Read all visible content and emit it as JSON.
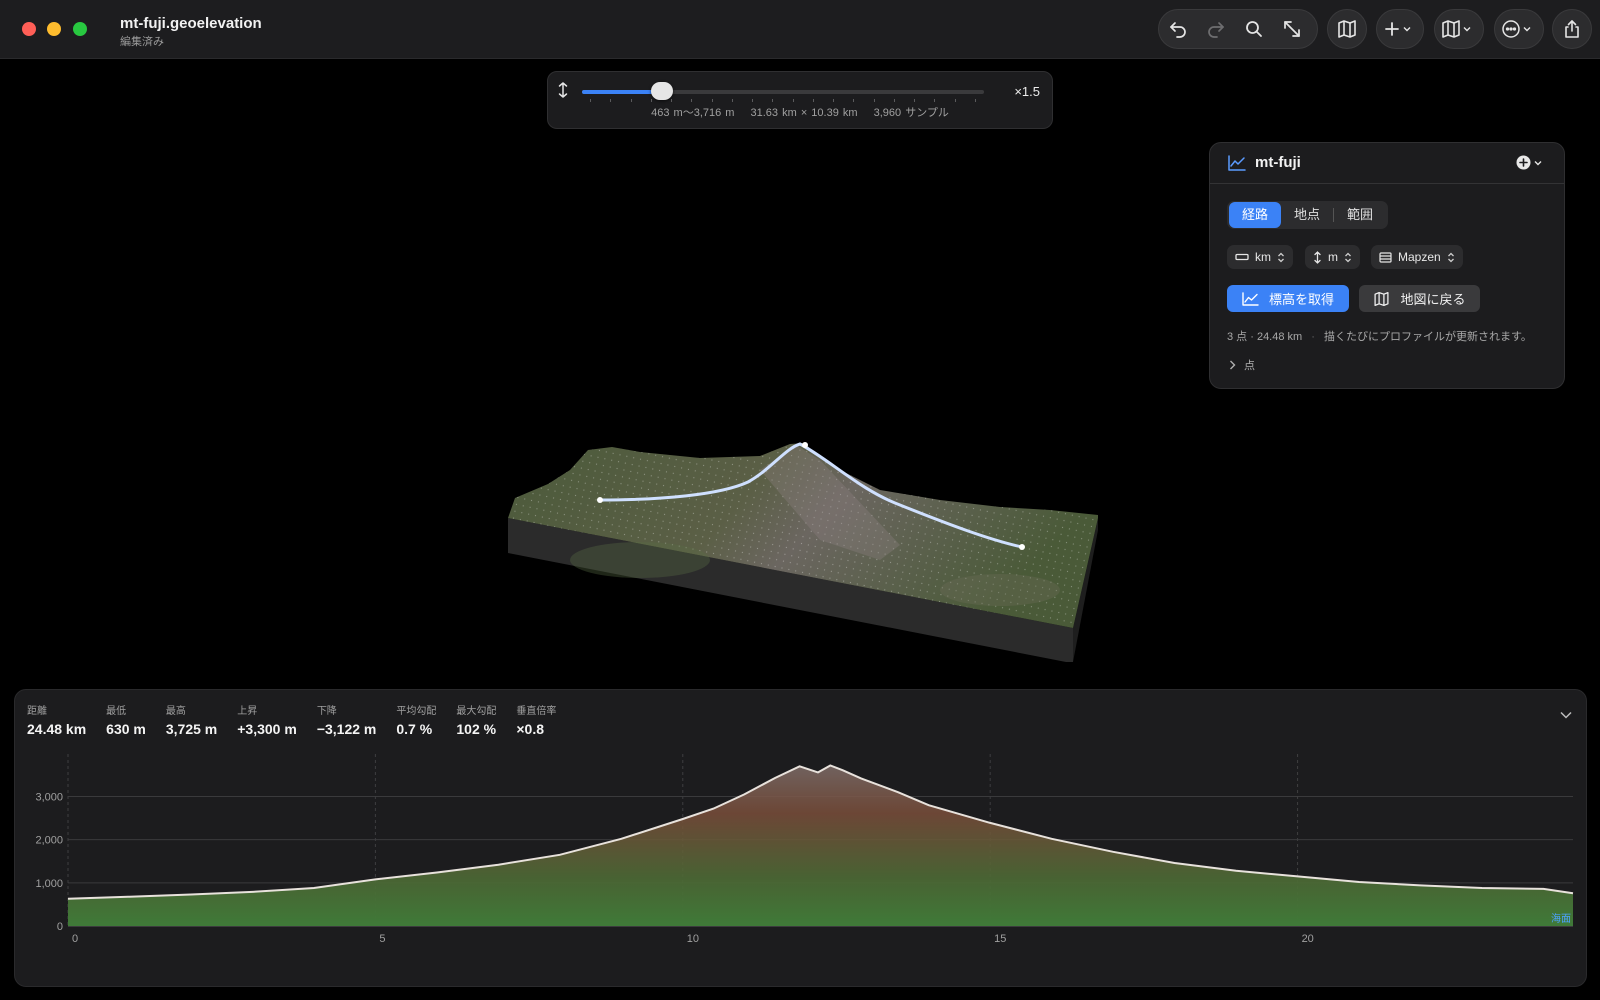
{
  "window": {
    "title": "mt-fuji.geoelevation",
    "subtitle": "編集済み"
  },
  "toolbar": {
    "undo": "undo-icon",
    "redo": "redo-icon",
    "search": "magnifier-icon",
    "fit": "fit-icon",
    "map_view": "map-icon",
    "add": "plus-icon",
    "map_style": "map-icon",
    "more": "ellipsis-icon",
    "share": "share-icon"
  },
  "exaggeration": {
    "multiplier": "×1.5",
    "slider_value": 0.2,
    "range_text": "463 m〜3,716 m",
    "size_text": "31.63 km × 10.39 km",
    "samples_text": "3,960 サンプル"
  },
  "inspector": {
    "title": "mt-fuji",
    "tabs": [
      {
        "label": "経路",
        "active": true
      },
      {
        "label": "地点",
        "active": false
      },
      {
        "label": "範囲",
        "active": false
      }
    ],
    "distance_unit": "km",
    "elevation_unit": "m",
    "source": "Mapzen",
    "fetch_button": "標高を取得",
    "back_button": "地図に戻る",
    "status_left": "3 点 · 24.48 km",
    "status_sep": "·",
    "status_right": "描くたびにプロファイルが更新されます。",
    "points_disclosure": "点"
  },
  "stats": [
    {
      "label": "距離",
      "value": "24.48 km"
    },
    {
      "label": "最低",
      "value": "630 m"
    },
    {
      "label": "最高",
      "value": "3,725 m"
    },
    {
      "label": "上昇",
      "value": "+3,300 m"
    },
    {
      "label": "下降",
      "value": "−3,122 m"
    },
    {
      "label": "平均勾配",
      "value": "0.7 %"
    },
    {
      "label": "最大勾配",
      "value": "102 %"
    },
    {
      "label": "垂直倍率",
      "value": "×0.8"
    }
  ],
  "chart_data": {
    "type": "area",
    "x_ticks": [
      "0",
      "5",
      "10",
      "15",
      "20"
    ],
    "y_ticks": [
      "0",
      "1,000",
      "2,000",
      "3,000"
    ],
    "xlim": [
      0,
      24.48
    ],
    "ylim": [
      0,
      3800
    ],
    "sea_level_label": "海面",
    "x": [
      0,
      1,
      2,
      3,
      4,
      5,
      6,
      7,
      8,
      9,
      10,
      10.5,
      11,
      11.5,
      11.9,
      12.2,
      12.4,
      12.6,
      12.9,
      13.5,
      14,
      15,
      16,
      17,
      18,
      19,
      20,
      21,
      22,
      23,
      24,
      24.48
    ],
    "y": [
      630,
      680,
      730,
      790,
      880,
      1080,
      1240,
      1420,
      1650,
      2020,
      2480,
      2720,
      3050,
      3430,
      3700,
      3560,
      3720,
      3610,
      3420,
      3100,
      2800,
      2390,
      2020,
      1720,
      1460,
      1280,
      1150,
      1020,
      940,
      880,
      860,
      760
    ]
  }
}
